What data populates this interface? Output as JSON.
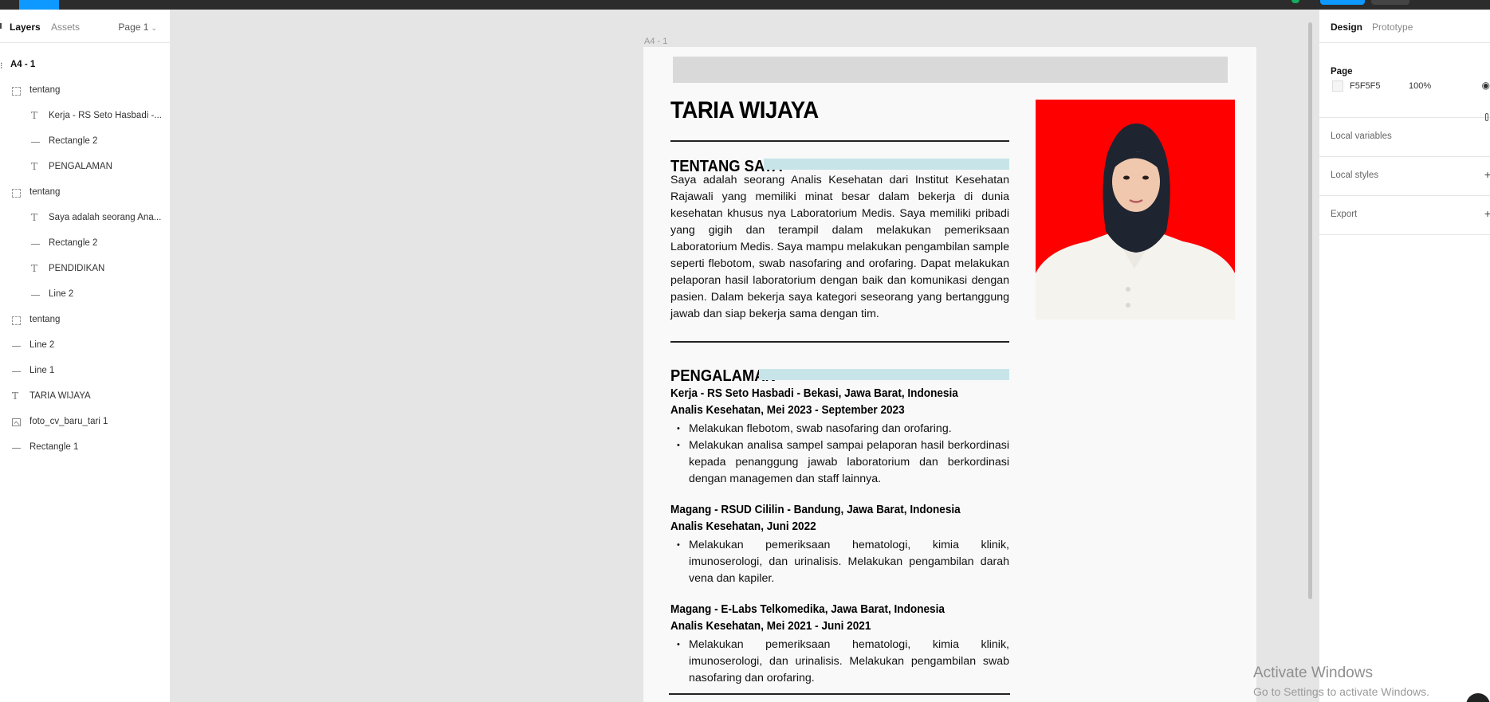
{
  "left_panel": {
    "tabs": [
      "Layers",
      "Assets"
    ],
    "page_selector": "Page 1",
    "frame_name": "A4 - 1",
    "layers": [
      {
        "label": "tentang",
        "type": "group"
      },
      {
        "label": "Kerja - RS Seto Hasbadi -...",
        "type": "text"
      },
      {
        "label": "Rectangle 2",
        "type": "line"
      },
      {
        "label": "PENGALAMAN",
        "type": "text"
      },
      {
        "label": "tentang",
        "type": "group"
      },
      {
        "label": "Saya adalah seorang Ana...",
        "type": "text"
      },
      {
        "label": "Rectangle 2",
        "type": "line"
      },
      {
        "label": "PENDIDIKAN",
        "type": "text"
      },
      {
        "label": "Line 2",
        "type": "line"
      },
      {
        "label": "tentang",
        "type": "group"
      },
      {
        "label": "Line 2",
        "type": "line"
      },
      {
        "label": "Line 1",
        "type": "line"
      },
      {
        "label": "TARIA WIJAYA",
        "type": "text"
      },
      {
        "label": "foto_cv_baru_tari 1",
        "type": "image"
      },
      {
        "label": "Rectangle 1",
        "type": "line"
      }
    ]
  },
  "canvas": {
    "frame_label": "A4 - 1",
    "cv": {
      "name": "TARIA WIJAYA",
      "about_heading": "TENTANG SAYA",
      "about_text": "Saya adalah seorang Analis Kesehatan dari Institut Kesehatan Rajawali yang memiliki minat besar dalam bekerja di dunia kesehatan khusus nya Laboratorium Medis. Saya memiliki pribadi yang gigih dan terampil dalam melakukan pemeriksaan Laboratorium Medis. Saya mampu melakukan pengambilan sample seperti flebotom, swab nasofaring and orofaring. Dapat melakukan pelaporan hasil laboratorium dengan baik dan komunikasi dengan pasien. Dalam bekerja saya kategori seseorang yang bertanggung jawab dan siap bekerja sama dengan tim.",
      "experience_heading": "PENGALAMAN",
      "jobs": [
        {
          "title": "Kerja - RS Seto Hasbadi - Bekasi, Jawa Barat, Indonesia",
          "role": "Analis Kesehatan, Mei 2023 - September 2023",
          "bullets": [
            "Melakukan flebotom, swab nasofaring dan orofaring.",
            "Melakukan analisa sampel sampai pelaporan hasil berkordinasi kepada penanggung jawab laboratorium dan berkordinasi dengan managemen dan staff lainnya."
          ]
        },
        {
          "title": "Magang - RSUD Cililin - Bandung, Jawa Barat, Indonesia",
          "role": "Analis Kesehatan, Juni 2022",
          "bullets": [
            "Melakukan pemeriksaan hematologi, kimia klinik, imunoserologi, dan urinalisis. Melakukan pengambilan darah vena dan kapiler."
          ]
        },
        {
          "title": "Magang - E-Labs Telkomedika, Jawa Barat, Indonesia",
          "role": "Analis Kesehatan, Mei 2021 - Juni 2021",
          "bullets": [
            "Melakukan pemeriksaan hematologi, kimia klinik, imunoserologi, dan urinalisis. Melakukan pengambilan swab nasofaring dan orofaring."
          ]
        }
      ]
    }
  },
  "right_panel": {
    "tabs": [
      "Design",
      "Prototype"
    ],
    "page_title": "Page",
    "page_color": "F5F5F5",
    "page_opacity": "100%",
    "local_variables": "Local variables",
    "local_styles": "Local styles",
    "export": "Export"
  },
  "watermark": {
    "line1": "Activate Windows",
    "line2": "Go to Settings to activate Windows."
  },
  "colors": {
    "accent": "#0d99ff",
    "section_bar": "#c7e5e9",
    "photo_background": "#ff0000"
  }
}
